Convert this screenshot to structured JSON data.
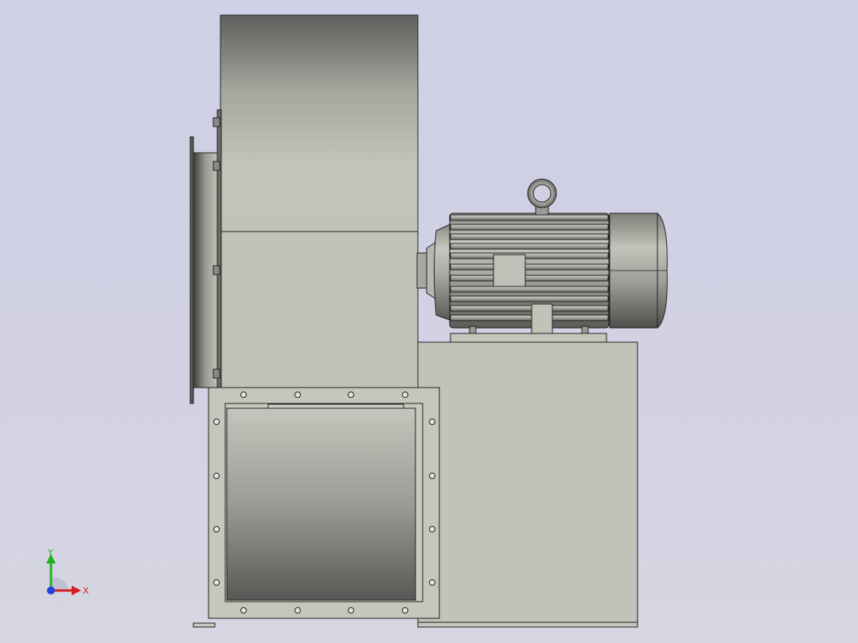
{
  "viewport": {
    "background_top": "#cfcfe6",
    "background_bottom": "#d6d6e2"
  },
  "model": {
    "body_color": "#c2c2b8",
    "edge_color": "#222222",
    "parts": [
      "fan-housing",
      "inlet-flange",
      "outlet-flange",
      "motor-base",
      "electric-motor",
      "lifting-eye"
    ]
  },
  "triad": {
    "x_label": "X",
    "y_label": "Y",
    "x_color": "#d42020",
    "y_color": "#20b020",
    "z_color": "#2040e0"
  }
}
